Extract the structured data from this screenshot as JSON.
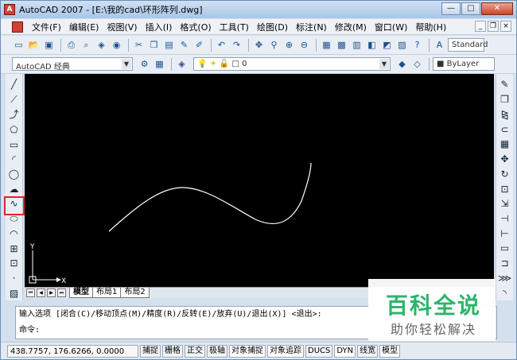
{
  "window": {
    "title": "AutoCAD 2007 - [E:\\我的cad\\环形阵列.dwg]",
    "app_icon": "A"
  },
  "window_buttons": {
    "minimize": "—",
    "maximize": "□",
    "close": "✕"
  },
  "menu": [
    {
      "label": "文件(F)"
    },
    {
      "label": "编辑(E)"
    },
    {
      "label": "视图(V)"
    },
    {
      "label": "插入(I)"
    },
    {
      "label": "格式(O)"
    },
    {
      "label": "工具(T)"
    },
    {
      "label": "绘图(D)"
    },
    {
      "label": "标注(N)"
    },
    {
      "label": "修改(M)"
    },
    {
      "label": "窗口(W)"
    },
    {
      "label": "帮助(H)"
    }
  ],
  "doc_buttons": {
    "minimize": "_",
    "restore": "❐",
    "close": "×"
  },
  "toolbar": {
    "text_style": "Standard"
  },
  "toolbar2": {
    "workspace": "AutoCAD 经典",
    "layer": "0",
    "color": "ByLayer"
  },
  "icons": {
    "left": [
      "line-icon",
      "construction-line-icon",
      "polyline-icon",
      "polygon-icon",
      "rectangle-icon",
      "arc-icon",
      "circle-icon",
      "revision-cloud-icon",
      "spline-icon",
      "ellipse-icon",
      "ellipse-arc-icon",
      "insert-block-icon",
      "make-block-icon",
      "point-icon",
      "hatch-icon"
    ],
    "right": [
      "erase-icon",
      "copy-icon",
      "mirror-icon",
      "offset-icon",
      "array-icon",
      "move-icon",
      "rotate-icon",
      "scale-icon",
      "stretch-icon",
      "trim-icon",
      "extend-icon",
      "break-icon",
      "join-icon",
      "chamfer-icon",
      "fillet-icon"
    ]
  },
  "canvas": {
    "background": "#000000",
    "curve_color": "#ffffff",
    "axis_x": "X",
    "axis_y": "Y"
  },
  "tabs": [
    {
      "label": "模型",
      "active": true
    },
    {
      "label": "布局1"
    },
    {
      "label": "布局2"
    }
  ],
  "command": {
    "line1": "输入选项 [闭合(C)/移动顶点(M)/精度(R)/反转(E)/放弃(U)/退出(X)] <退出>:",
    "line2": "命令:"
  },
  "status": {
    "coords": "438.7757, 176.6266, 0.0000",
    "buttons": [
      {
        "label": "捕捉"
      },
      {
        "label": "栅格"
      },
      {
        "label": "正交"
      },
      {
        "label": "极轴"
      },
      {
        "label": "对象捕捉"
      },
      {
        "label": "对象追踪"
      },
      {
        "label": "DUCS"
      },
      {
        "label": "DYN"
      },
      {
        "label": "线宽"
      },
      {
        "label": "模型"
      }
    ]
  },
  "watermark": {
    "title": "百科全说",
    "subtitle": "助你轻松解决"
  },
  "highlight_color": "#e0252a"
}
